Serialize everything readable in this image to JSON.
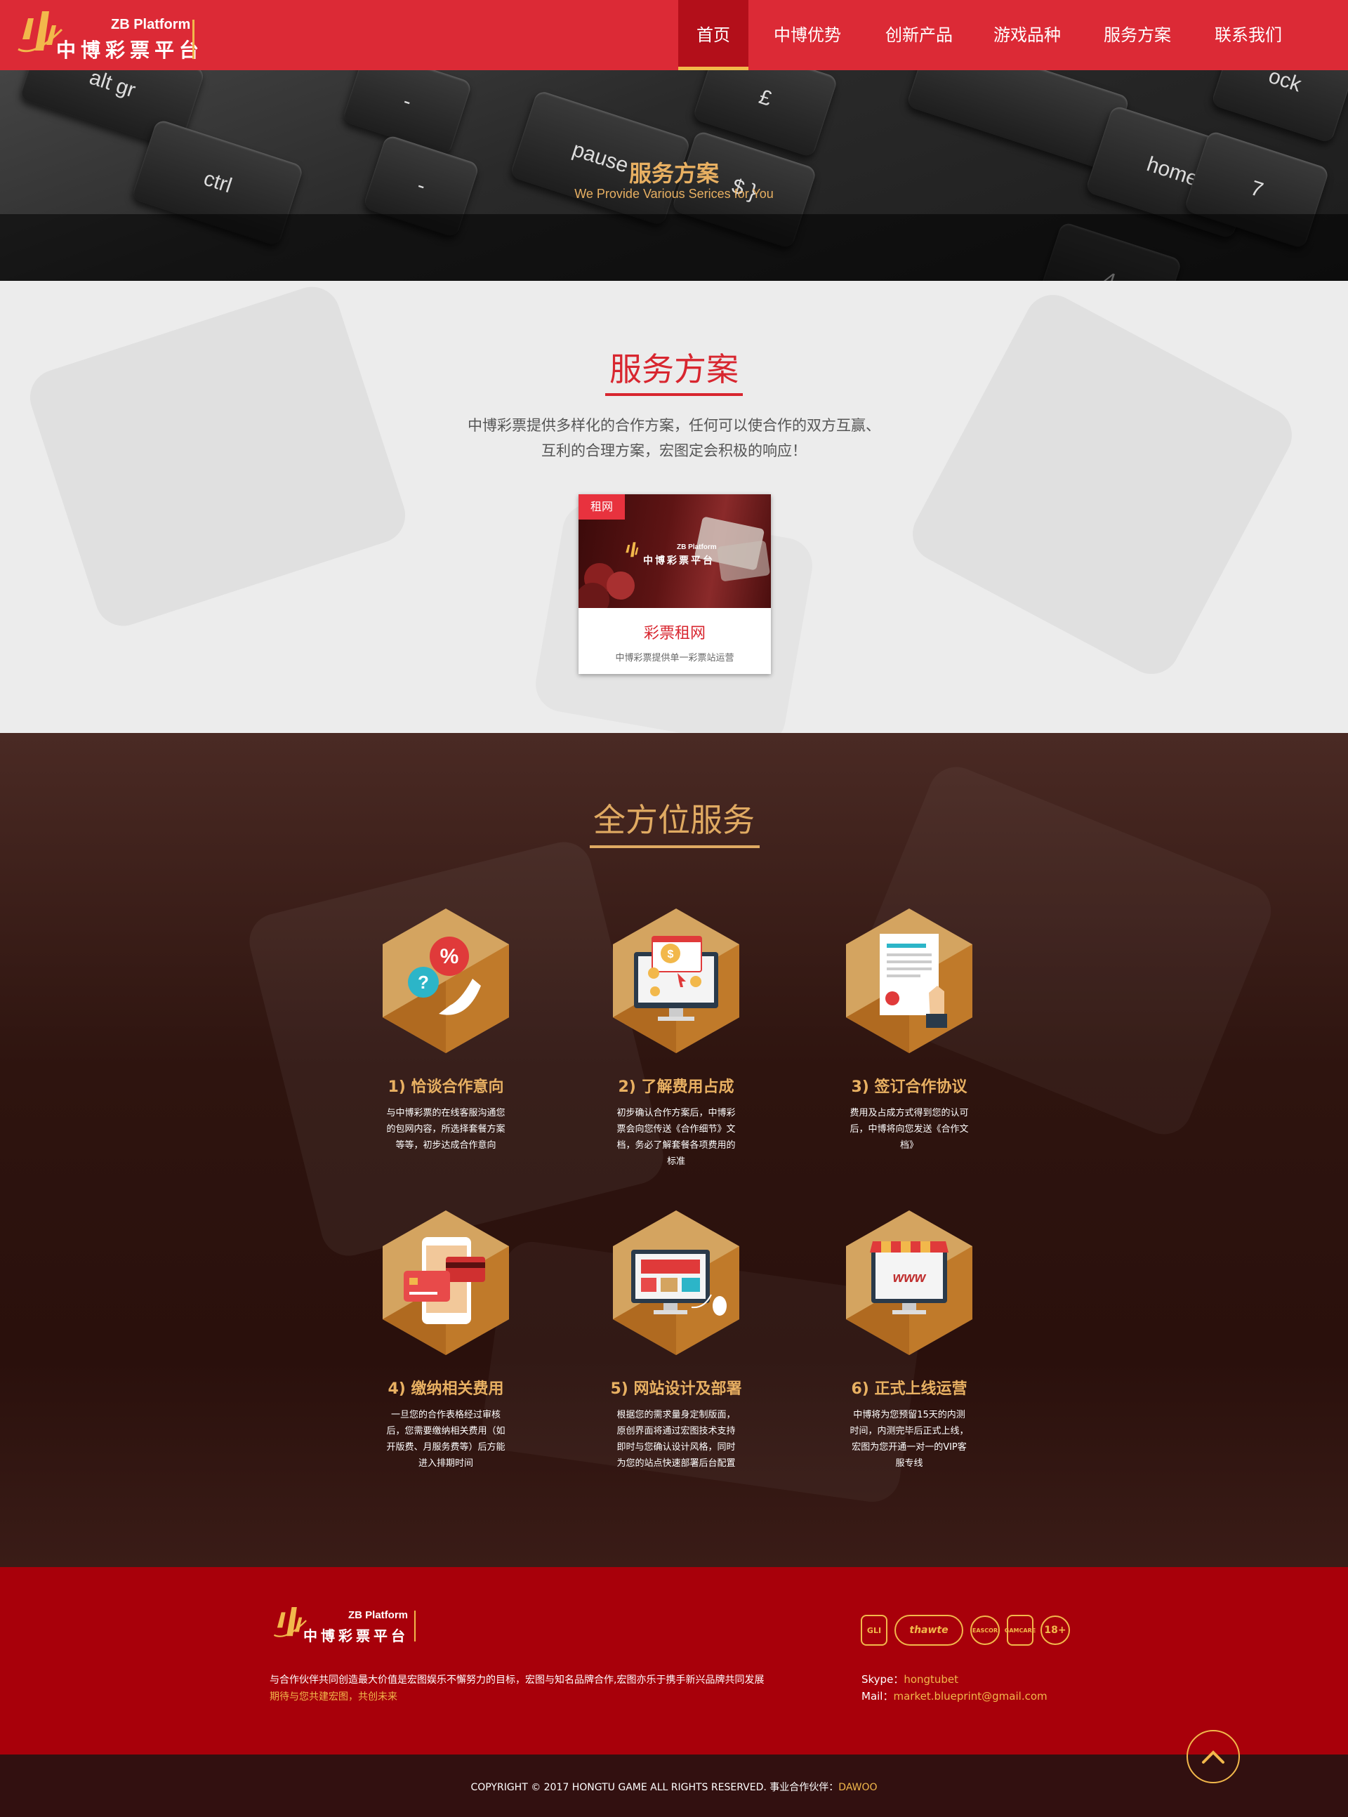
{
  "header": {
    "logo_en": "ZB Platform",
    "logo_cn": "中博彩票平台",
    "nav": [
      {
        "label": "首页",
        "active": true
      },
      {
        "label": "中博优势",
        "active": false
      },
      {
        "label": "创新产品",
        "active": false
      },
      {
        "label": "游戏品种",
        "active": false
      },
      {
        "label": "服务方案",
        "active": false
      },
      {
        "label": "联系我们",
        "active": false
      }
    ]
  },
  "banner": {
    "title": "服务方案",
    "subtitle": "We Provide Various Serices for You",
    "keys": [
      "alt gr",
      "ctrl",
      "-",
      "pause",
      "£",
      "$ }",
      "home",
      "7",
      "4",
      "-",
      "ock"
    ]
  },
  "plan": {
    "title": "服务方案",
    "desc_line1": "中博彩票提供多样化的合作方案，任何可以使合作的双方互赢、",
    "desc_line2": "互利的合理方案，宏图定会积极的响应！",
    "card": {
      "tag": "租网",
      "logo_en": "ZB Platform",
      "logo_cn": "中博彩票平台",
      "title": "彩票租网",
      "desc": "中博彩票提供单一彩票站运营"
    }
  },
  "full_service": {
    "title": "全方位服务",
    "steps": [
      {
        "title": "1) 恰谈合作意向",
        "desc": "与中博彩票的在线客服沟通您的包网内容，所选择套餐方案等等，初步达成合作意向",
        "icon": "phone-percent-icon"
      },
      {
        "title": "2) 了解费用占成",
        "desc": "初步确认合作方案后，中博彩票会向您传送《合作细节》文档，务必了解套餐各项费用的标准",
        "icon": "monitor-coins-icon"
      },
      {
        "title": "3) 签订合作协议",
        "desc": "费用及占成方式得到您的认可后，中博将向您发送《合作文档》",
        "icon": "contract-icon"
      },
      {
        "title": "4) 缴纳相关费用",
        "desc": "一旦您的合作表格经过审核后，您需要缴纳相关费用（如开版费、月服务费等）后方能进入排期时间",
        "icon": "credit-card-icon"
      },
      {
        "title": "5) 网站设计及部署",
        "desc": "根据您的需求量身定制版面，原创界面将通过宏图技术支持即时与您确认设计风格，同时为您的站点快速部署后台配置",
        "icon": "website-design-icon"
      },
      {
        "title": "6) 正式上线运营",
        "desc": "中博将为您预留15天的内测时间，内测完毕后正式上线，宏图为您开通一对一的VIP客服专线",
        "icon": "www-store-icon"
      }
    ]
  },
  "footer": {
    "logo_en": "ZB Platform",
    "logo_cn": "中博彩票平台",
    "text1": "与合作伙伴共同创造最大价值是宏图娱乐不懈努力的目标，宏图与知名品牌合作,宏图亦乐于携手新兴品牌共同发展",
    "text2": "期待与您共建宏图，共创未来",
    "badges": [
      "GLI",
      "thawte",
      "EASCOR",
      "GAMCARE",
      "18+"
    ],
    "skype_label": "Skype：",
    "skype_value": "hongtubet",
    "mail_label": "Mail：",
    "mail_value": "market.blueprint@gmail.com"
  },
  "copyright": {
    "text": "COPYRIGHT © 2017 HONGTU GAME ALL RIGHTS RESERVED.   事业合作伙伴：",
    "partner": "DAWOO"
  },
  "colors": {
    "brand_red": "#dc2a36",
    "nav_active": "#b30f1a",
    "gold": "#f2b84b",
    "footer_red": "#a8000a",
    "title_red": "#d8262f"
  }
}
